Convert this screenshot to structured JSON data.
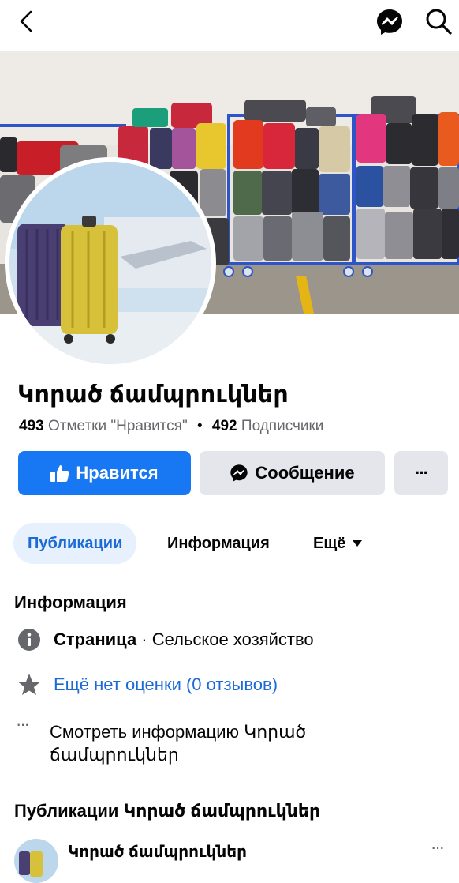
{
  "header": {
    "back_icon": "chevron-left-icon",
    "messenger_icon": "messenger-icon",
    "search_icon": "search-icon"
  },
  "profile": {
    "name": "Կորած ճամպրուկներ",
    "likes_count": "493",
    "likes_label": "Отметки \"Нравится\"",
    "separator": "•",
    "followers_count": "492",
    "followers_label": "Подписчики"
  },
  "actions": {
    "like_label": "Нравится",
    "message_label": "Сообщение",
    "more_label": "···"
  },
  "tabs": [
    {
      "label": "Публикации",
      "active": true
    },
    {
      "label": "Информация",
      "active": false
    },
    {
      "label": "Ещё",
      "active": false
    }
  ],
  "info": {
    "title": "Информация",
    "page_type_bold": "Страница",
    "page_type_rest": " · Сельское хозяйство",
    "rating": "Ещё нет оценки (0 отзывов)",
    "see_more_line1": "Смотреть информацию Կորած",
    "see_more_line2": "ճամպրուկներ"
  },
  "posts": {
    "title": "Публикации Կորած ճամպրուկներ",
    "first_author": "Կորած ճամպրուկներ",
    "more_label": "···"
  },
  "colors": {
    "accent": "#1877f2",
    "link": "#1b6ad6",
    "secondary_button": "#e4e6eb",
    "muted_text": "#65676b"
  }
}
